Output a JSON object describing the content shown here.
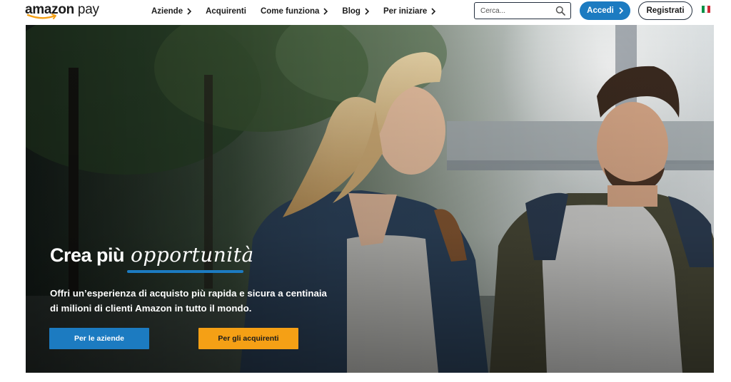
{
  "header": {
    "logo": {
      "word1": "amazon",
      "word2": " pay"
    },
    "nav": [
      {
        "label": "Aziende",
        "has_chevron": true
      },
      {
        "label": "Acquirenti",
        "has_chevron": false
      },
      {
        "label": "Come funziona",
        "has_chevron": true
      },
      {
        "label": "Blog",
        "has_chevron": true
      },
      {
        "label": "Per iniziare",
        "has_chevron": true
      }
    ],
    "search": {
      "placeholder": "Cerca...",
      "value": ""
    },
    "login_label": "Accedi",
    "register_label": "Registrati",
    "language_flag": "italy-flag-icon"
  },
  "hero": {
    "title": "Crea più",
    "title_script": "opportunità",
    "subtitle": "Offri un’esperienza di acquisto più rapida e sicura a centinaia di milioni di clienti Amazon in tutto il mondo.",
    "cta_business": "Per le aziende",
    "cta_shoppers": "Per gli acquirenti"
  },
  "colors": {
    "brand_blue": "#1c7bc1",
    "brand_orange": "#f5a015",
    "dark": "#232f3e",
    "flag_green": "#009246",
    "flag_white": "#ffffff",
    "flag_red": "#ce2b37"
  }
}
